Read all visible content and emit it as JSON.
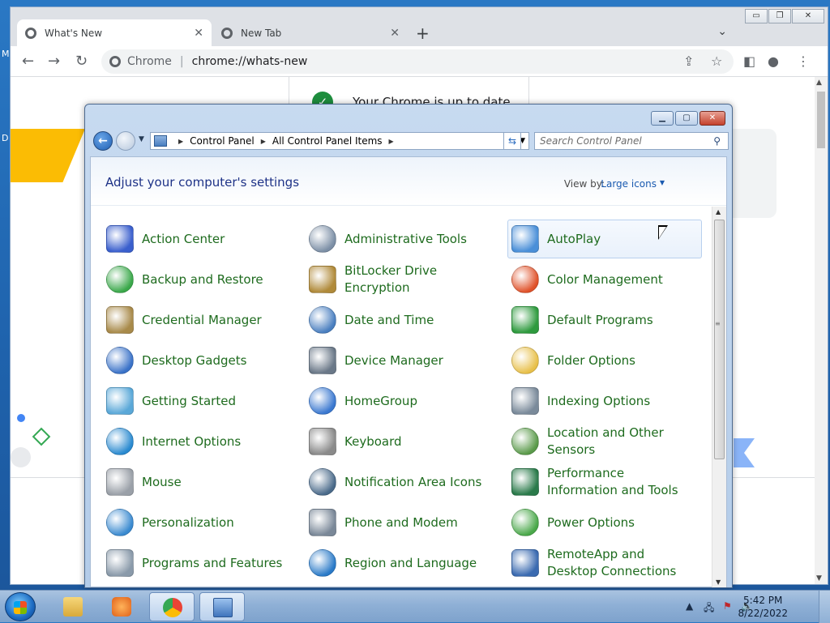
{
  "desktop": {
    "frag1": "M",
    "frag2": "D"
  },
  "chrome": {
    "tabs": [
      {
        "title": "What's New",
        "active": true
      },
      {
        "title": "New Tab",
        "active": false
      }
    ],
    "window_controls": {
      "minimize": "▭",
      "maximize": "❐",
      "close": "✕"
    },
    "omnibox": {
      "site_label": "Chrome",
      "url": "chrome://whats-new"
    },
    "page": {
      "status_text": "Your Chrome is up to date"
    }
  },
  "control_panel": {
    "window_controls": {
      "minimize": "▁",
      "maximize": "▢",
      "close": "✕"
    },
    "breadcrumb": [
      "Control Panel",
      "All Control Panel Items"
    ],
    "search_placeholder": "Search Control Panel",
    "heading": "Adjust your computer's settings",
    "view_by_label": "View by:",
    "view_by_value": "Large icons",
    "items": [
      {
        "label": "Action Center",
        "icon": "flag-icon"
      },
      {
        "label": "Administrative Tools",
        "icon": "admin-tools-icon"
      },
      {
        "label": "AutoPlay",
        "icon": "autoplay-icon",
        "hover": true
      },
      {
        "label": "Backup and Restore",
        "icon": "backup-icon"
      },
      {
        "label": "BitLocker Drive Encryption",
        "icon": "bitlocker-icon"
      },
      {
        "label": "Color Management",
        "icon": "color-management-icon"
      },
      {
        "label": "Credential Manager",
        "icon": "credential-icon"
      },
      {
        "label": "Date and Time",
        "icon": "calendar-clock-icon"
      },
      {
        "label": "Default Programs",
        "icon": "default-programs-icon"
      },
      {
        "label": "Desktop Gadgets",
        "icon": "gadgets-icon"
      },
      {
        "label": "Device Manager",
        "icon": "device-manager-icon"
      },
      {
        "label": "Folder Options",
        "icon": "folder-icon"
      },
      {
        "label": "Getting Started",
        "icon": "getting-started-icon"
      },
      {
        "label": "HomeGroup",
        "icon": "homegroup-icon"
      },
      {
        "label": "Indexing Options",
        "icon": "indexing-icon"
      },
      {
        "label": "Internet Options",
        "icon": "internet-options-icon"
      },
      {
        "label": "Keyboard",
        "icon": "keyboard-icon"
      },
      {
        "label": "Location and Other Sensors",
        "icon": "location-icon"
      },
      {
        "label": "Mouse",
        "icon": "mouse-icon"
      },
      {
        "label": "Notification Area Icons",
        "icon": "notification-icon"
      },
      {
        "label": "Performance Information and Tools",
        "icon": "performance-icon"
      },
      {
        "label": "Personalization",
        "icon": "personalization-icon"
      },
      {
        "label": "Phone and Modem",
        "icon": "phone-icon"
      },
      {
        "label": "Power Options",
        "icon": "power-icon"
      },
      {
        "label": "Programs and Features",
        "icon": "programs-icon"
      },
      {
        "label": "Region and Language",
        "icon": "region-icon"
      },
      {
        "label": "RemoteApp and Desktop Connections",
        "icon": "remoteapp-icon"
      }
    ],
    "icon_colors": [
      "#3a5fcd",
      "#7c8fa6",
      "#4a8fd8",
      "#3aa84a",
      "#b08a3a",
      "#e0522a",
      "#a88a4a",
      "#4a7fc0",
      "#2e9a3e",
      "#3a72c8",
      "#6a7888",
      "#e8c04a",
      "#5aa8d8",
      "#3a78d0",
      "#7a8a9a",
      "#2a8ad0",
      "#8a8a8a",
      "#5a9a4a",
      "#9aa0a8",
      "#4a6a8a",
      "#2a7a4a",
      "#3a8ad0",
      "#7a8898",
      "#4aa84a",
      "#8a9aaa",
      "#2a7ac8",
      "#3a6ab0"
    ]
  },
  "taskbar": {
    "time": "5:42 PM",
    "date": "8/22/2022"
  }
}
